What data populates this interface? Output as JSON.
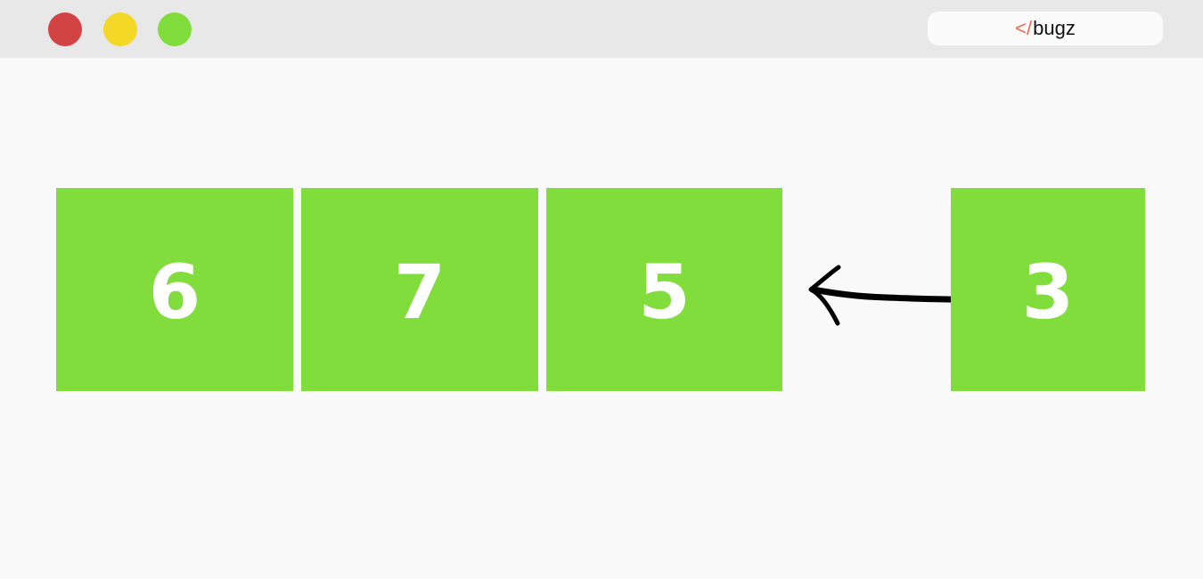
{
  "window": {
    "controls": [
      {
        "name": "close",
        "color": "#d24343"
      },
      {
        "name": "minimize",
        "color": "#f3d825"
      },
      {
        "name": "maximize",
        "color": "#80dd3b"
      }
    ],
    "address": {
      "brand_mark": "</",
      "brand_mark_color": "#ef6b4f",
      "brand_text": "bugz"
    }
  },
  "diagram": {
    "box_color": "#80dd3b",
    "text_color": "#ffffff",
    "array_values": [
      "6",
      "7",
      "5"
    ],
    "incoming_value": "3",
    "arrow_icon": "left-arrow-icon",
    "arrow_color": "#000000"
  }
}
